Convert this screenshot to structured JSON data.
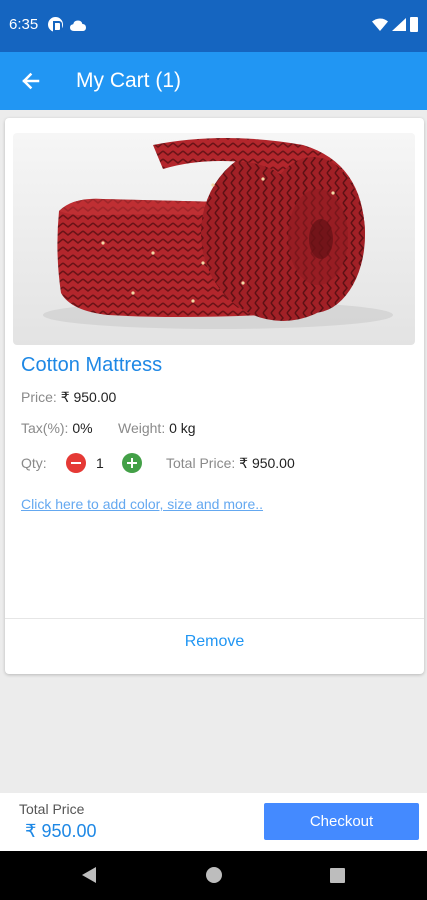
{
  "status_bar": {
    "time": "6:35",
    "icons": [
      "p-icon",
      "cloud-icon",
      "wifi-icon",
      "signal-icon",
      "battery-icon"
    ]
  },
  "app_bar": {
    "title": "My Cart (1)",
    "back_icon": "arrow-left-icon"
  },
  "cart_item": {
    "name": "Cotton Mattress",
    "image": "rolled-mattress-image",
    "price_label": "Price:",
    "price_value": "₹ 950.00",
    "tax_label": "Tax(%):",
    "tax_value": "0%",
    "weight_label": "Weight:",
    "weight_value": "0 kg",
    "qty_label": "Qty:",
    "qty_value": "1",
    "total_label": "Total Price:",
    "total_value": "₹ 950.00",
    "options_link": "Click here to add color, size and more..",
    "remove_label": "Remove"
  },
  "bottom_bar": {
    "total_label": "Total Price",
    "total_value": "₹ 950.00",
    "checkout_label": "Checkout"
  },
  "colors": {
    "status_bar": "#1565c0",
    "app_bar": "#2196f3",
    "accent_blue": "#1e88e5",
    "checkout": "#448aff",
    "minus": "#e53935",
    "plus": "#43a047"
  }
}
